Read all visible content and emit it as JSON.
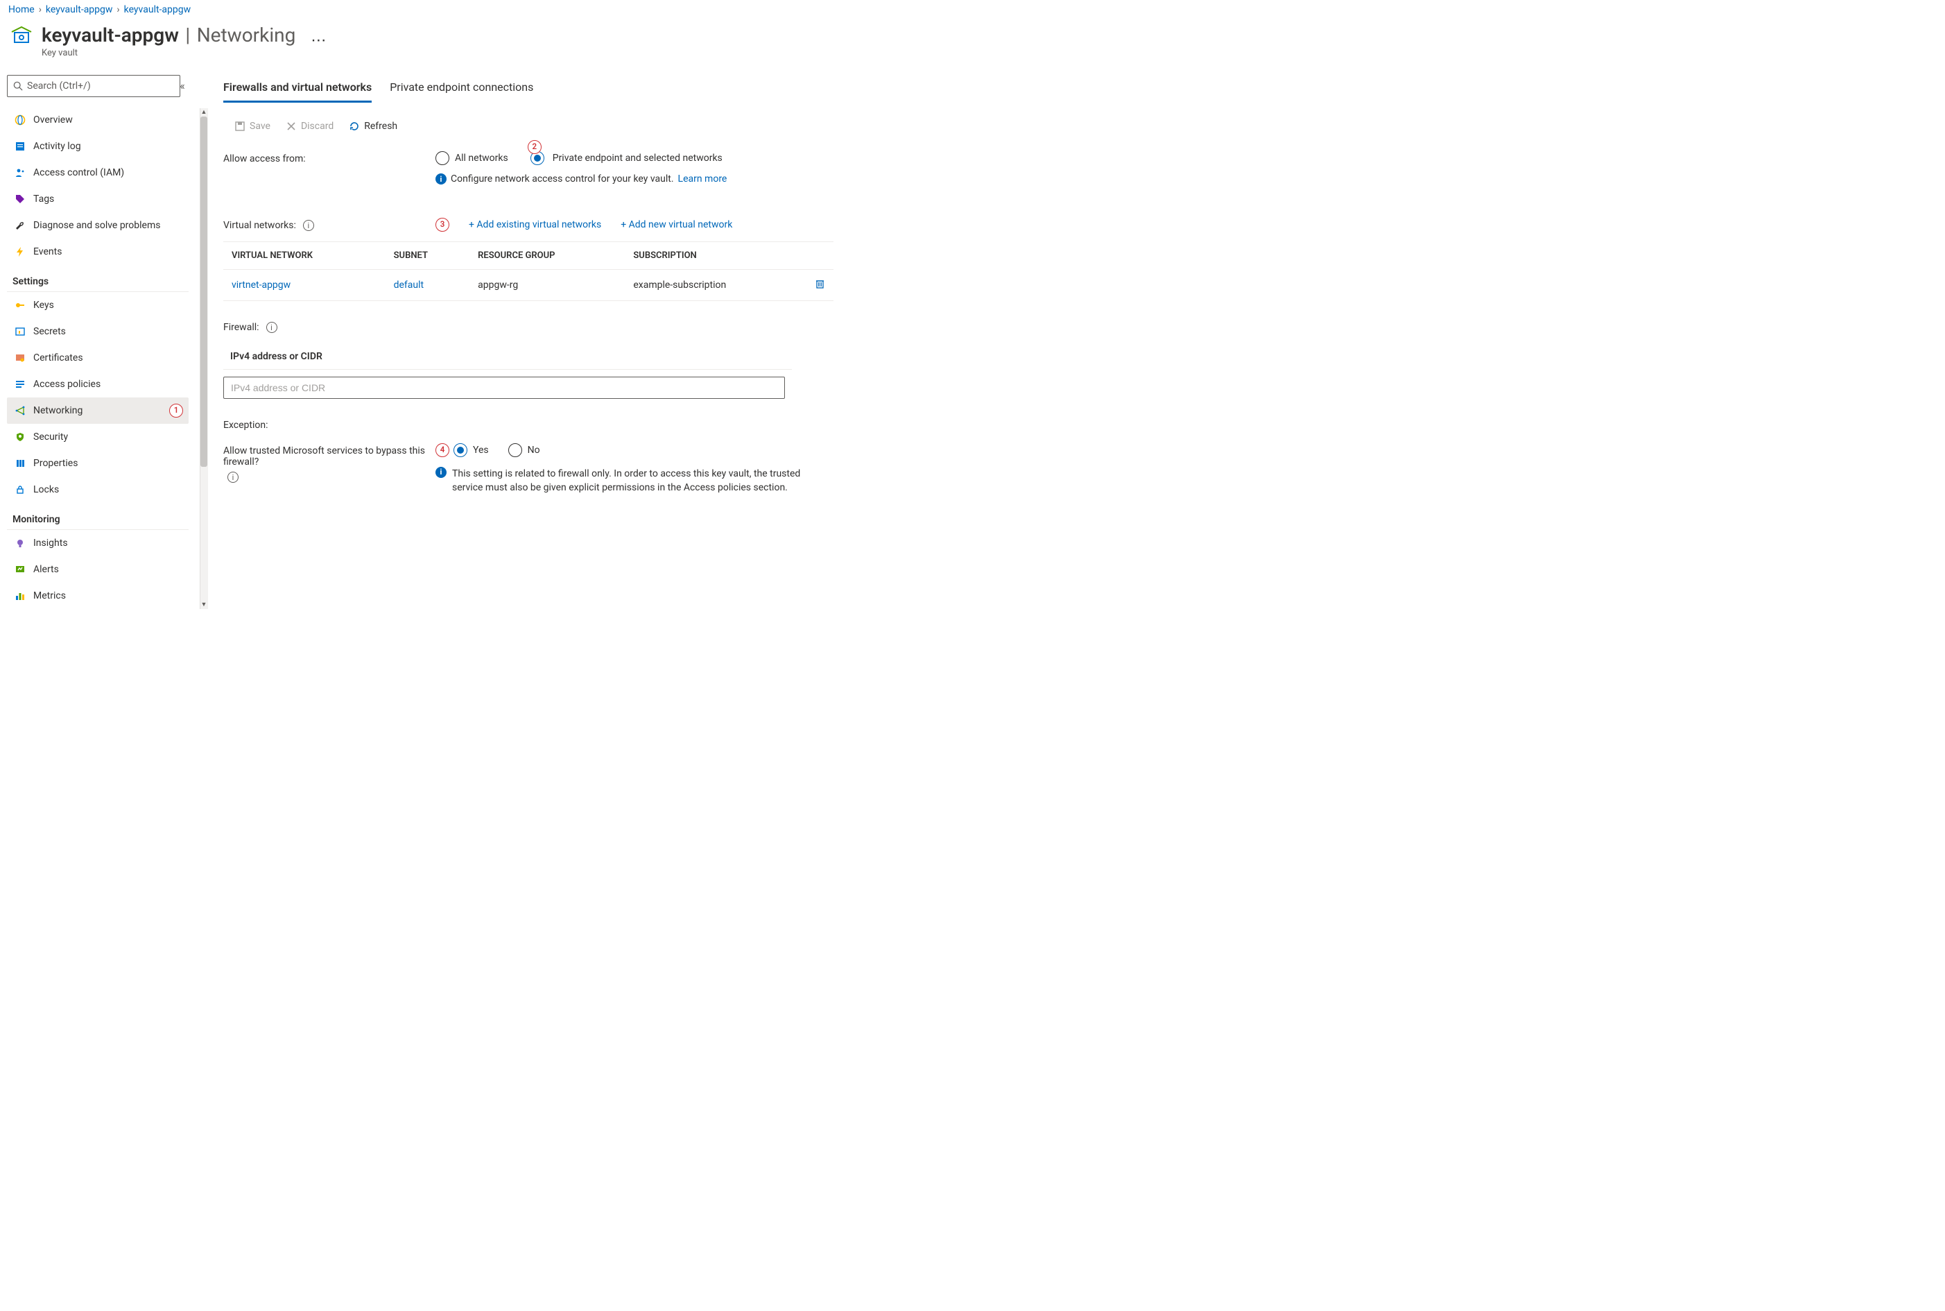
{
  "breadcrumb": {
    "items": [
      "Home",
      "keyvault-appgw",
      "keyvault-appgw"
    ]
  },
  "header": {
    "resource_name": "keyvault-appgw",
    "title_sep": "|",
    "blade_title": "Networking",
    "resource_type": "Key vault"
  },
  "sidebar": {
    "search_placeholder": "Search (Ctrl+/)",
    "items": [
      {
        "label": "Overview",
        "icon": "globe",
        "colors": [
          "#ffb900",
          "#0078d4"
        ]
      },
      {
        "label": "Activity log",
        "icon": "log",
        "colors": [
          "#0078d4"
        ]
      },
      {
        "label": "Access control (IAM)",
        "icon": "iam",
        "colors": [
          "#0078d4"
        ]
      },
      {
        "label": "Tags",
        "icon": "tag",
        "colors": [
          "#7719aa"
        ]
      },
      {
        "label": "Diagnose and solve problems",
        "icon": "wrench",
        "colors": [
          "#323130"
        ]
      },
      {
        "label": "Events",
        "icon": "bolt",
        "colors": [
          "#ffb900"
        ]
      }
    ],
    "groups": [
      {
        "name": "Settings",
        "items": [
          {
            "label": "Keys",
            "icon": "key",
            "colors": [
              "#ffb900"
            ]
          },
          {
            "label": "Secrets",
            "icon": "secret",
            "colors": [
              "#ffffff",
              "#0078d4",
              "#ffb900"
            ]
          },
          {
            "label": "Certificates",
            "icon": "cert",
            "colors": [
              "#e8825d",
              "#ffffff"
            ]
          },
          {
            "label": "Access policies",
            "icon": "list",
            "colors": [
              "#0078d4"
            ]
          },
          {
            "label": "Networking",
            "icon": "net",
            "selected": true,
            "badge": "1",
            "colors": [
              "#57a300",
              "#0078d4"
            ]
          },
          {
            "label": "Security",
            "icon": "shield",
            "colors": [
              "#57a300",
              "#ffffff"
            ]
          },
          {
            "label": "Properties",
            "icon": "props",
            "colors": [
              "#0078d4"
            ]
          },
          {
            "label": "Locks",
            "icon": "lock",
            "colors": [
              "#0078d4"
            ]
          }
        ]
      },
      {
        "name": "Monitoring",
        "items": [
          {
            "label": "Insights",
            "icon": "bulb",
            "colors": [
              "#8661c5"
            ]
          },
          {
            "label": "Alerts",
            "icon": "alert",
            "colors": [
              "#57a300",
              "#ffffff"
            ]
          },
          {
            "label": "Metrics",
            "icon": "bars",
            "colors": [
              "#0078d4",
              "#57a300",
              "#ffb900"
            ]
          }
        ]
      }
    ]
  },
  "main": {
    "tabs": [
      {
        "label": "Firewalls and virtual networks",
        "active": true
      },
      {
        "label": "Private endpoint connections",
        "active": false
      }
    ],
    "toolbar": {
      "save": "Save",
      "discard": "Discard",
      "refresh": "Refresh"
    },
    "access": {
      "label": "Allow access from:",
      "options": [
        "All networks",
        "Private endpoint and selected networks"
      ],
      "selected": 1,
      "badge": "2",
      "info_text": "Configure network access control for your key vault.",
      "learn_more": "Learn more"
    },
    "vnets": {
      "label": "Virtual networks:",
      "badge": "3",
      "add_existing": "+ Add existing virtual networks",
      "add_new": "+ Add new virtual network",
      "headers": [
        "VIRTUAL NETWORK",
        "SUBNET",
        "RESOURCE GROUP",
        "SUBSCRIPTION"
      ],
      "rows": [
        {
          "vnet": "virtnet-appgw",
          "subnet": "default",
          "rg": "appgw-rg",
          "sub": "example-subscription"
        }
      ]
    },
    "firewall": {
      "label": "Firewall:",
      "field_head": "IPv4 address or CIDR",
      "placeholder": "IPv4 address or CIDR"
    },
    "exception": {
      "section": "Exception:",
      "label": "Allow trusted Microsoft services to bypass this firewall?",
      "badge": "4",
      "options": [
        "Yes",
        "No"
      ],
      "selected": 0,
      "info": "This setting is related to firewall only. In order to access this key vault, the trusted service must also be given explicit permissions in the Access policies section."
    }
  }
}
